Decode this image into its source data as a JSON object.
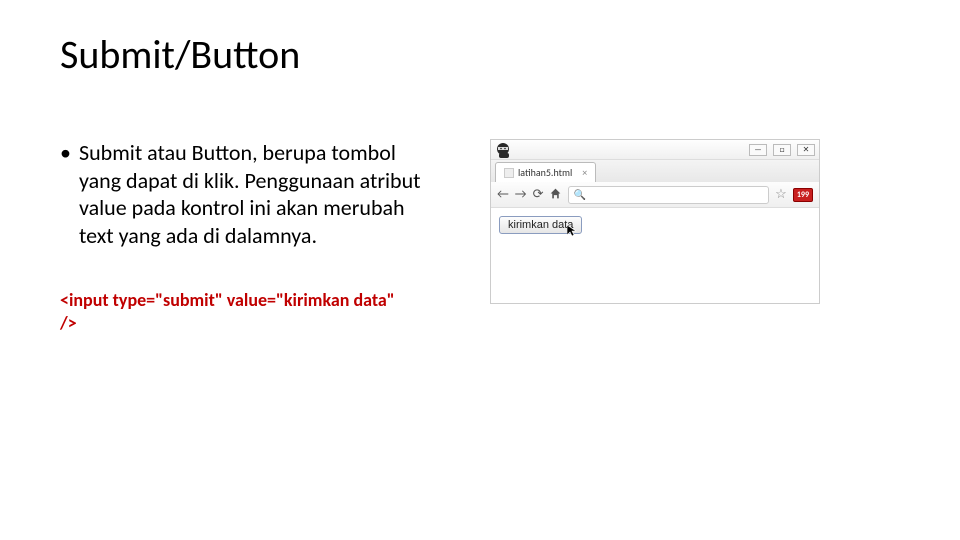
{
  "title": "Submit/Button",
  "bullet_text": "Submit atau Button, berupa tombol yang dapat di klik. Penggunaan atribut value pada kontrol ini akan merubah text yang ada di dalamnya.",
  "code_line1": "<input type=\"submit\" value=\"kirimkan data\"",
  "code_line2": "/>",
  "browser": {
    "tab_label": "latihan5.html",
    "page_button_label": "kirimkan data",
    "badge": "199",
    "win_min": "—",
    "win_max": "□",
    "win_close": "✕"
  }
}
